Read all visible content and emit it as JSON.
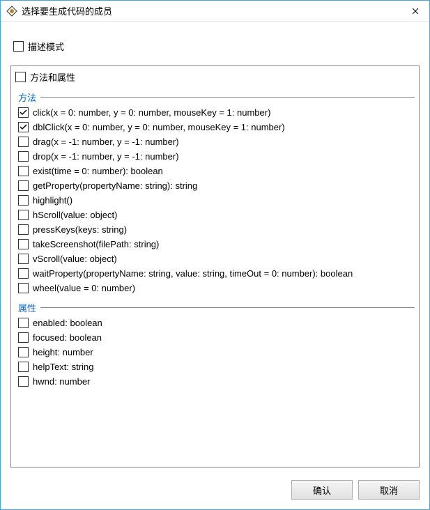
{
  "window": {
    "title": "选择要生成代码的成员"
  },
  "describeMode": {
    "label": "描述模式",
    "checked": false
  },
  "root": {
    "label": "方法和属性",
    "checked": false
  },
  "groups": [
    {
      "name": "方法",
      "items": [
        {
          "label": "click(x = 0: number, y = 0: number, mouseKey = 1: number)",
          "checked": true
        },
        {
          "label": "dblClick(x = 0: number, y = 0: number, mouseKey = 1: number)",
          "checked": true
        },
        {
          "label": "drag(x = -1: number, y = -1: number)",
          "checked": false
        },
        {
          "label": "drop(x = -1: number, y = -1: number)",
          "checked": false
        },
        {
          "label": "exist(time = 0: number): boolean",
          "checked": false
        },
        {
          "label": "getProperty(propertyName: string): string",
          "checked": false
        },
        {
          "label": "highlight()",
          "checked": false
        },
        {
          "label": "hScroll(value: object)",
          "checked": false
        },
        {
          "label": "pressKeys(keys: string)",
          "checked": false
        },
        {
          "label": "takeScreenshot(filePath: string)",
          "checked": false
        },
        {
          "label": "vScroll(value: object)",
          "checked": false
        },
        {
          "label": "waitProperty(propertyName: string, value: string, timeOut = 0: number): boolean",
          "checked": false
        },
        {
          "label": "wheel(value = 0: number)",
          "checked": false
        }
      ]
    },
    {
      "name": "属性",
      "items": [
        {
          "label": "enabled: boolean",
          "checked": false
        },
        {
          "label": "focused: boolean",
          "checked": false
        },
        {
          "label": "height: number",
          "checked": false
        },
        {
          "label": "helpText: string",
          "checked": false
        },
        {
          "label": "hwnd: number",
          "checked": false
        }
      ]
    }
  ],
  "buttons": {
    "ok": "确认",
    "cancel": "取消"
  }
}
